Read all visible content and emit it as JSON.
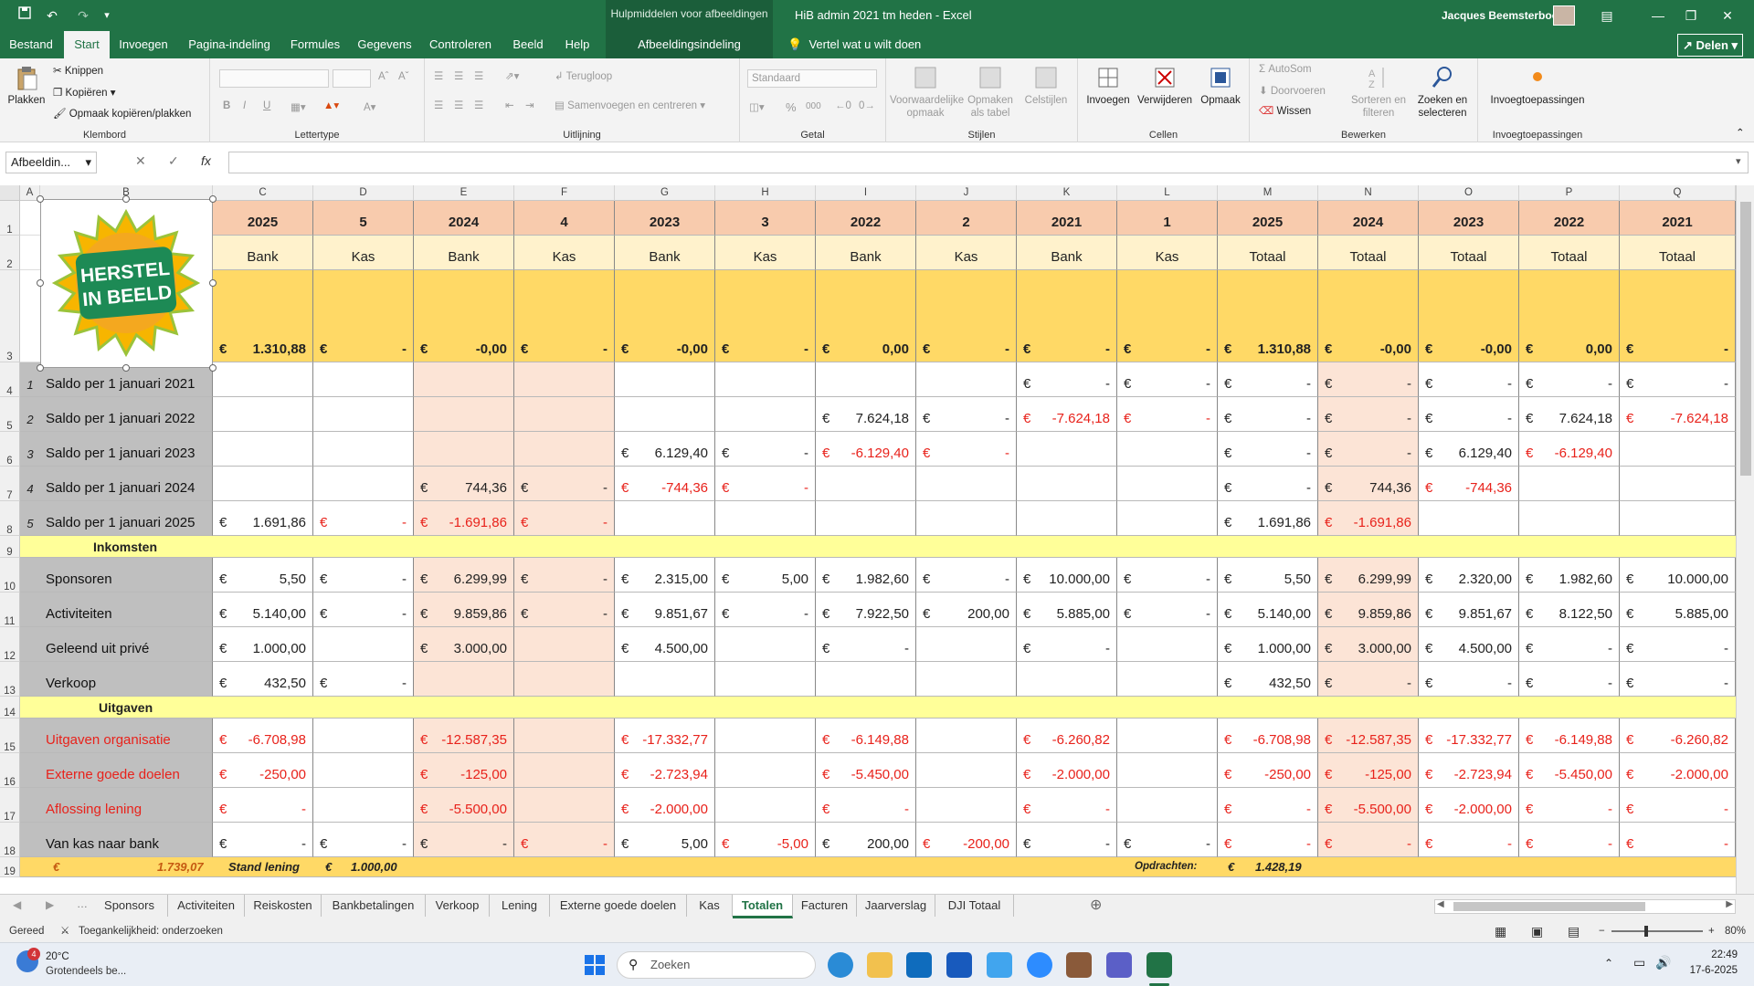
{
  "titlebar": {
    "context_label": "Hulpmiddelen voor afbeeldingen",
    "doc_title": "HiB admin 2021 tm heden  -  Excel",
    "user_name": "Jacques Beemsterboer"
  },
  "ribbon_tabs": [
    "Bestand",
    "Start",
    "Invoegen",
    "Pagina-indeling",
    "Formules",
    "Gegevens",
    "Controleren",
    "Beeld",
    "Help"
  ],
  "active_tab": "Start",
  "context_tab": "Afbeeldingsindeling",
  "tell_me": "Vertel wat u wilt doen",
  "share_label": "Delen",
  "ribbon": {
    "clipboard": {
      "paste": "Plakken",
      "cut": "Knippen",
      "copy": "Kopiëren",
      "format_painter": "Opmaak kopiëren/plakken",
      "label": "Klembord"
    },
    "font": {
      "label": "Lettertype",
      "bold": "B",
      "italic": "I",
      "underline": "U"
    },
    "alignment": {
      "wrap": "Terugloop",
      "merge": "Samenvoegen en centreren",
      "label": "Uitlijning"
    },
    "number": {
      "format": "Standaard",
      "label": "Getal",
      "percent": "%",
      "thousands": "000"
    },
    "styles": {
      "conditional": "Voorwaardelijke opmaak",
      "table": "Opmaken als tabel",
      "cell": "Celstijlen",
      "label": "Stijlen"
    },
    "cells": {
      "insert": "Invoegen",
      "delete": "Verwijderen",
      "format": "Opmaak",
      "label": "Cellen"
    },
    "editing": {
      "autosum": "AutoSom",
      "fill": "Doorvoeren",
      "clear": "Wissen",
      "sort": "Sorteren en filteren",
      "find": "Zoeken en selecteren",
      "label": "Bewerken"
    },
    "addins": {
      "button": "Invoegtoepassingen",
      "label": "Invoegtoepassingen"
    }
  },
  "formula_bar": {
    "name_box": "Afbeeldin...",
    "fx": "fx",
    "formula": ""
  },
  "columns": [
    "A",
    "B",
    "C",
    "D",
    "E",
    "F",
    "G",
    "H",
    "I",
    "J",
    "K",
    "L",
    "M",
    "N",
    "O",
    "P",
    "Q"
  ],
  "row_numbers": [
    "1",
    "2",
    "3",
    "4",
    "5",
    "6",
    "7",
    "8",
    "9",
    "10",
    "11",
    "12",
    "13",
    "14",
    "15",
    "16",
    "17",
    "18",
    "19"
  ],
  "header_years": [
    "2025",
    "5",
    "2024",
    "4",
    "2023",
    "3",
    "2022",
    "2",
    "2021",
    "1",
    "2025",
    "2024",
    "2023",
    "2022",
    "2021"
  ],
  "header_types": [
    "Bank",
    "Kas",
    "Bank",
    "Kas",
    "Bank",
    "Kas",
    "Bank",
    "Kas",
    "Bank",
    "Kas",
    "Totaal",
    "Totaal",
    "Totaal",
    "Totaal",
    "Totaal"
  ],
  "totals_row": [
    {
      "v": "1.310,88",
      "red": false
    },
    {
      "v": "-",
      "red": false
    },
    {
      "v": "-0,00",
      "red": false
    },
    {
      "v": "-",
      "red": false
    },
    {
      "v": "-0,00",
      "red": false
    },
    {
      "v": "-",
      "red": false
    },
    {
      "v": "0,00",
      "red": false
    },
    {
      "v": "-",
      "red": false
    },
    {
      "v": "-",
      "red": false
    },
    {
      "v": "-",
      "red": false
    },
    {
      "v": "1.310,88",
      "red": false
    },
    {
      "v": "-0,00",
      "red": false
    },
    {
      "v": "-0,00",
      "red": false
    },
    {
      "v": "0,00",
      "red": false
    },
    {
      "v": "-",
      "red": false
    }
  ],
  "currency": "€",
  "logo_text": [
    "HERSTEL",
    "IN BEELD"
  ],
  "rows": [
    {
      "num": "1",
      "label": "Saldo per 1 januari 2021",
      "red_label": false,
      "cells": [
        null,
        null,
        null,
        null,
        null,
        null,
        null,
        null,
        {
          "v": "-"
        },
        {
          "v": "-"
        },
        {
          "v": "-"
        },
        {
          "v": "-"
        },
        {
          "v": "-"
        },
        {
          "v": "-"
        },
        {
          "v": "-"
        }
      ]
    },
    {
      "num": "2",
      "label": "Saldo per 1 januari 2022",
      "red_label": false,
      "cells": [
        null,
        null,
        null,
        null,
        null,
        null,
        {
          "v": "7.624,18"
        },
        {
          "v": "-"
        },
        {
          "v": "-7.624,18",
          "r": true
        },
        {
          "v": "-",
          "r": true
        },
        {
          "v": "-"
        },
        {
          "v": "-"
        },
        {
          "v": "-"
        },
        {
          "v": "7.624,18"
        },
        {
          "v": "-7.624,18",
          "r": true
        }
      ]
    },
    {
      "num": "3",
      "label": "Saldo per 1 januari 2023",
      "red_label": false,
      "cells": [
        null,
        null,
        null,
        null,
        {
          "v": "6.129,40"
        },
        {
          "v": "-"
        },
        {
          "v": "-6.129,40",
          "r": true
        },
        {
          "v": "-",
          "r": true
        },
        null,
        null,
        {
          "v": "-"
        },
        {
          "v": "-"
        },
        {
          "v": "6.129,40"
        },
        {
          "v": "-6.129,40",
          "r": true
        },
        null
      ]
    },
    {
      "num": "4",
      "label": "Saldo per 1 januari 2024",
      "red_label": false,
      "cells": [
        null,
        null,
        {
          "v": "744,36"
        },
        {
          "v": "-"
        },
        {
          "v": "-744,36",
          "r": true
        },
        {
          "v": "-",
          "r": true
        },
        null,
        null,
        null,
        null,
        {
          "v": "-"
        },
        {
          "v": "744,36"
        },
        {
          "v": "-744,36",
          "r": true
        },
        null,
        null
      ]
    },
    {
      "num": "5",
      "label": "Saldo per 1 januari 2025",
      "red_label": false,
      "cells": [
        {
          "v": "1.691,86"
        },
        {
          "v": "-",
          "r": true
        },
        {
          "v": "-1.691,86",
          "r": true
        },
        {
          "v": "-",
          "r": true
        },
        null,
        null,
        null,
        null,
        null,
        null,
        {
          "v": "1.691,86"
        },
        {
          "v": "-1.691,86",
          "r": true
        },
        null,
        null,
        null
      ]
    },
    {
      "section": "Inkomsten"
    },
    {
      "num": "",
      "label": "Sponsoren",
      "red_label": false,
      "cells": [
        {
          "v": "5,50"
        },
        {
          "v": "-"
        },
        {
          "v": "6.299,99"
        },
        {
          "v": "-"
        },
        {
          "v": "2.315,00"
        },
        {
          "v": "5,00"
        },
        {
          "v": "1.982,60"
        },
        {
          "v": "-"
        },
        {
          "v": "10.000,00"
        },
        {
          "v": "-"
        },
        {
          "v": "5,50"
        },
        {
          "v": "6.299,99"
        },
        {
          "v": "2.320,00"
        },
        {
          "v": "1.982,60"
        },
        {
          "v": "10.000,00"
        }
      ]
    },
    {
      "num": "",
      "label": "Activiteiten",
      "red_label": false,
      "cells": [
        {
          "v": "5.140,00"
        },
        {
          "v": "-"
        },
        {
          "v": "9.859,86"
        },
        {
          "v": "-"
        },
        {
          "v": "9.851,67"
        },
        {
          "v": "-"
        },
        {
          "v": "7.922,50"
        },
        {
          "v": "200,00"
        },
        {
          "v": "5.885,00"
        },
        {
          "v": "-"
        },
        {
          "v": "5.140,00"
        },
        {
          "v": "9.859,86"
        },
        {
          "v": "9.851,67"
        },
        {
          "v": "8.122,50"
        },
        {
          "v": "5.885,00"
        }
      ]
    },
    {
      "num": "",
      "label": "Geleend uit privé",
      "red_label": false,
      "cells": [
        {
          "v": "1.000,00"
        },
        null,
        {
          "v": "3.000,00"
        },
        null,
        {
          "v": "4.500,00"
        },
        null,
        {
          "v": "-"
        },
        null,
        {
          "v": "-"
        },
        null,
        {
          "v": "1.000,00"
        },
        {
          "v": "3.000,00"
        },
        {
          "v": "4.500,00"
        },
        {
          "v": "-"
        },
        {
          "v": "-"
        }
      ]
    },
    {
      "num": "",
      "label": "Verkoop",
      "red_label": false,
      "cells": [
        {
          "v": "432,50"
        },
        {
          "v": "-"
        },
        null,
        null,
        null,
        null,
        null,
        null,
        null,
        null,
        {
          "v": "432,50"
        },
        {
          "v": "-"
        },
        {
          "v": "-"
        },
        {
          "v": "-"
        },
        {
          "v": "-"
        }
      ]
    },
    {
      "section": "Uitgaven"
    },
    {
      "num": "",
      "label": "Uitgaven organisatie",
      "red_label": true,
      "cells": [
        {
          "v": "-6.708,98",
          "r": true
        },
        null,
        {
          "v": "-12.587,35",
          "r": true
        },
        null,
        {
          "v": "-17.332,77",
          "r": true
        },
        null,
        {
          "v": "-6.149,88",
          "r": true
        },
        null,
        {
          "v": "-6.260,82",
          "r": true
        },
        null,
        {
          "v": "-6.708,98",
          "r": true
        },
        {
          "v": "-12.587,35",
          "r": true
        },
        {
          "v": "-17.332,77",
          "r": true
        },
        {
          "v": "-6.149,88",
          "r": true
        },
        {
          "v": "-6.260,82",
          "r": true
        }
      ]
    },
    {
      "num": "",
      "label": "Externe goede doelen",
      "red_label": true,
      "cells": [
        {
          "v": "-250,00",
          "r": true
        },
        null,
        {
          "v": "-125,00",
          "r": true
        },
        null,
        {
          "v": "-2.723,94",
          "r": true
        },
        null,
        {
          "v": "-5.450,00",
          "r": true
        },
        null,
        {
          "v": "-2.000,00",
          "r": true
        },
        null,
        {
          "v": "-250,00",
          "r": true
        },
        {
          "v": "-125,00",
          "r": true
        },
        {
          "v": "-2.723,94",
          "r": true
        },
        {
          "v": "-5.450,00",
          "r": true
        },
        {
          "v": "-2.000,00",
          "r": true
        }
      ]
    },
    {
      "num": "",
      "label": "Aflossing lening",
      "red_label": true,
      "cells": [
        {
          "v": "-",
          "r": true
        },
        null,
        {
          "v": "-5.500,00",
          "r": true
        },
        null,
        {
          "v": "-2.000,00",
          "r": true
        },
        null,
        {
          "v": "-",
          "r": true
        },
        null,
        {
          "v": "-",
          "r": true
        },
        null,
        {
          "v": "-",
          "r": true
        },
        {
          "v": "-5.500,00",
          "r": true
        },
        {
          "v": "-2.000,00",
          "r": true
        },
        {
          "v": "-",
          "r": true
        },
        {
          "v": "-",
          "r": true
        }
      ]
    },
    {
      "num": "",
      "label": "Van kas naar bank",
      "red_label": false,
      "cells": [
        {
          "v": "-"
        },
        {
          "v": "-"
        },
        {
          "v": "-"
        },
        {
          "v": "-",
          "r": true
        },
        {
          "v": "5,00"
        },
        {
          "v": "-5,00",
          "r": true
        },
        {
          "v": "200,00"
        },
        {
          "v": "-200,00",
          "r": true
        },
        {
          "v": "-"
        },
        {
          "v": "-"
        },
        {
          "v": "-",
          "r": true
        },
        {
          "v": "-",
          "r": true
        },
        {
          "v": "-",
          "r": true
        },
        {
          "v": "-",
          "r": true
        },
        {
          "v": "-",
          "r": true
        }
      ]
    }
  ],
  "row19": {
    "amount_1": "1.739,07",
    "stand_label": "Stand lening",
    "amount_2": "1.000,00",
    "opdrachten_label": "Opdrachten:",
    "amount_3": "1.428,19"
  },
  "sheet_tabs": [
    "Sponsors",
    "Activiteiten",
    "Reiskosten",
    "Bankbetalingen",
    "Verkoop",
    "Lening",
    "Externe goede doelen",
    "Kas",
    "Totalen",
    "Facturen",
    "Jaarverslag",
    "DJI Totaal"
  ],
  "active_sheet": "Totalen",
  "status": {
    "ready": "Gereed",
    "accessibility": "Toegankelijkheid: onderzoeken",
    "zoom": "80%"
  },
  "taskbar": {
    "weather_temp": "20°C",
    "weather_desc": "Grotendeels be...",
    "weather_badge": "4",
    "search": "Zoeken",
    "time": "22:49",
    "date": "17-6-2025"
  },
  "colors": {
    "excel_green": "#217346",
    "header_orange": "#f8cbad",
    "header_yellow": "#fff2cc",
    "total_yellow": "#ffd966",
    "section_yellow": "#ffff99",
    "label_gray": "#bfbfbf",
    "pink": "#fce4d6",
    "red": "#e8221b"
  }
}
